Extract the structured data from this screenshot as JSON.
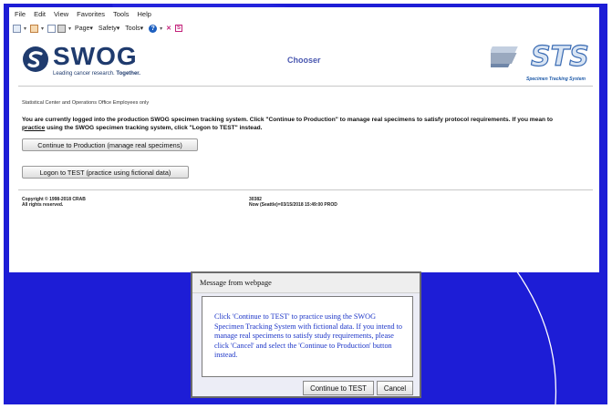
{
  "colors": {
    "background": "#1d1dd6",
    "swog_navy": "#1f3b6e",
    "dialog_text": "#1c35c7",
    "chooser_title": "#4a58b0"
  },
  "browser": {
    "menu": [
      "File",
      "Edit",
      "View",
      "Favorites",
      "Tools",
      "Help"
    ],
    "toolbar": {
      "page_label": "Page",
      "safety_label": "Safety",
      "tools_label": "Tools",
      "icons": [
        "home-icon",
        "feeds-icon",
        "mail-icon",
        "print-icon",
        "help-icon",
        "research-icon",
        "snagit-icon"
      ]
    }
  },
  "page": {
    "logo_text": "SWOG",
    "logo_tagline": "Leading cancer research.",
    "logo_tagline_bold": "Together.",
    "title": "Chooser",
    "sts_logo_text": "STS",
    "sts_logo_subtitle": "Specimen Tracking System",
    "employee_note": "Statistical Center and Operations Office Employees only",
    "warning_part1": "You are currently logged into the production SWOG specimen tracking system. Click \"Continue to Production\" to manage real specimens to satisfy protocol requirements. If you mean to",
    "warning_link": "practice",
    "warning_part2": "using the SWOG specimen tracking system, click \"Logon to TEST\" instead.",
    "continue_button": "Continue to Production (manage real specimens)",
    "logon_test_button": "Logon to TEST (practice using fictional data)",
    "footer_copyright": "Copyright © 1998-2018 CRAB",
    "footer_rights": "All rights reserved.",
    "footer_code": "30382",
    "footer_time": "Now (Seattle)=03/15/2018 15:49:00   PROD"
  },
  "dialog": {
    "title": "Message from webpage",
    "message": "Click 'Continue to TEST' to practice using the SWOG Specimen Tracking System with fictional data. If you intend to manage real specimens to satisfy study requirements, please click 'Cancel' and select the 'Continue to Production' button instead.",
    "ok_button": "Continue to TEST",
    "cancel_button": "Cancel"
  }
}
